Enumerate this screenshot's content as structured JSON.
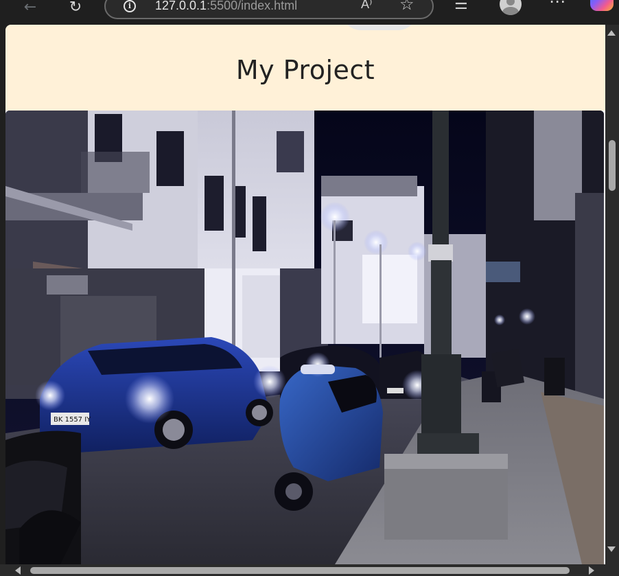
{
  "browser": {
    "address": {
      "host": "127.0.0.1",
      "rest": ":5500/index.html"
    },
    "readaloud_label": "A⁾",
    "icons": {
      "back": "back-arrow-icon",
      "refresh": "refresh-icon",
      "info": "info-icon",
      "read_aloud": "read-aloud-icon",
      "favorite": "star-icon",
      "collections": "collections-icon",
      "profile": "profile-icon",
      "more": "more-icon",
      "copilot": "copilot-icon"
    }
  },
  "page": {
    "title": "My Project",
    "header_background": "#fff1d8",
    "hero_image": "night-street-photo"
  },
  "scrollbars": {
    "vertical": "visible",
    "horizontal": "visible"
  }
}
